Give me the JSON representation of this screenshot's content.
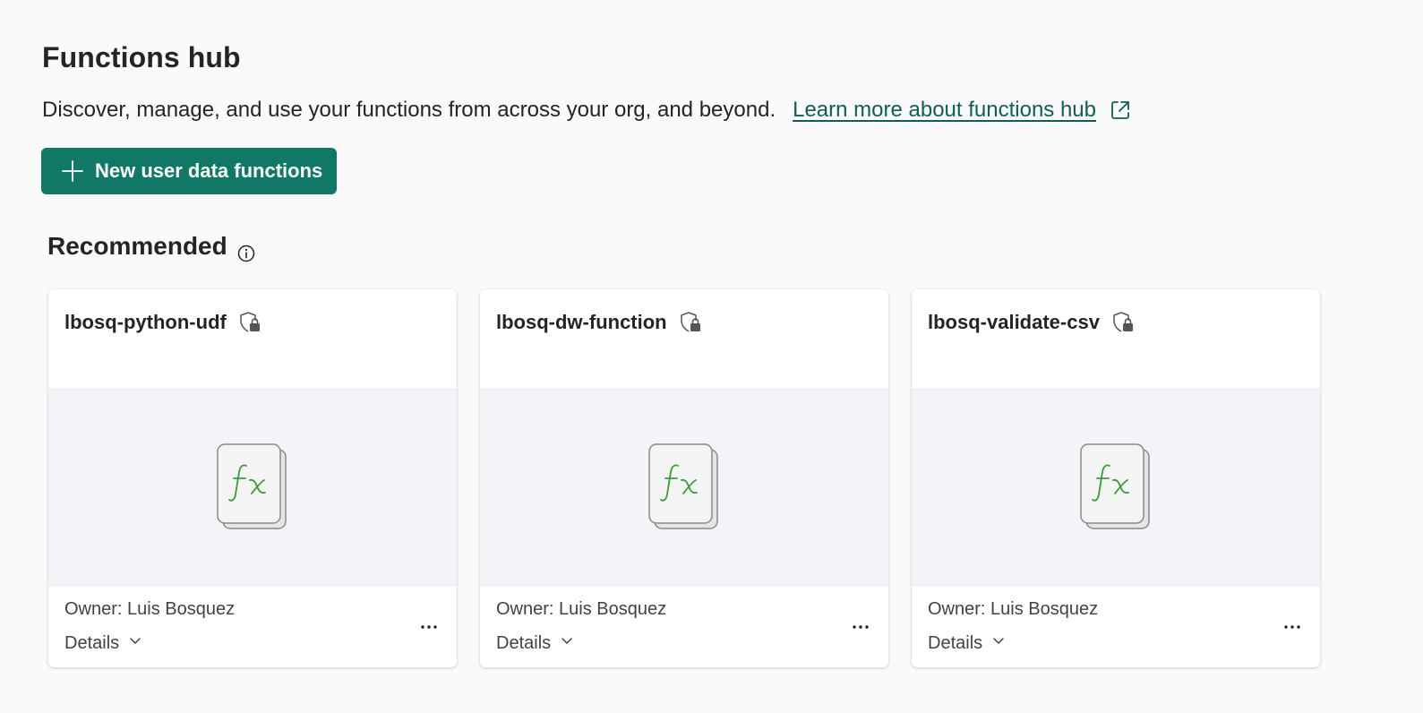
{
  "header": {
    "title": "Functions hub",
    "description": "Discover, manage, and use your functions from across your org, and beyond.",
    "learn_more_label": "Learn more about functions hub"
  },
  "actions": {
    "new_button_label": "New user data functions"
  },
  "recommended": {
    "title": "Recommended",
    "cards": [
      {
        "name": "lbosq-python-udf",
        "owner": "Owner: Luis Bosquez",
        "details_label": "Details"
      },
      {
        "name": "lbosq-dw-function",
        "owner": "Owner: Luis Bosquez",
        "details_label": "Details"
      },
      {
        "name": "lbosq-validate-csv",
        "owner": "Owner: Luis Bosquez",
        "details_label": "Details"
      }
    ]
  },
  "colors": {
    "primary_button": "#117865",
    "link": "#115e54",
    "fx_glyph": "#3a9a3a",
    "preview_bg": "#f3f4f8"
  },
  "icons": {
    "external_link": "external-link-icon",
    "plus": "plus-icon",
    "info": "info-icon",
    "lock": "shield-lock-icon",
    "function": "fx-function-icon",
    "chevron": "chevron-down-icon",
    "more": "more-options-icon"
  }
}
